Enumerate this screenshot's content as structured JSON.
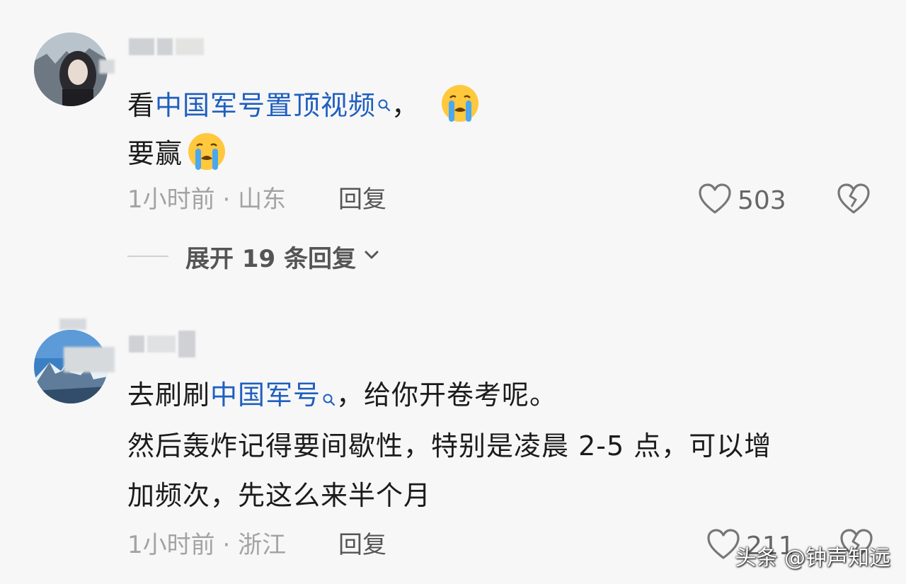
{
  "comments": [
    {
      "username": "",
      "line1_before": "看",
      "line1_link": "中国军号置顶视频",
      "line1_after": "，",
      "line2": "要赢",
      "time": "1小时前",
      "location": "山东",
      "reply_label": "回复",
      "like_count": "503",
      "emoji": "loudly-crying-face"
    },
    {
      "username": "",
      "line1_before": "去刷刷",
      "line1_link": "中国军号",
      "line1_after": "，给你开卷考呢。",
      "line2": "然后轰炸记得要间歇性，特别是凌晨 2-5 点，可以增",
      "line3": "加频次，先这么来半个月",
      "time": "1小时前",
      "location": "浙江",
      "reply_label": "回复",
      "like_count": "211"
    }
  ],
  "expand_replies": {
    "label": "展开 19 条回复"
  },
  "watermark": "头条 @钟声知远",
  "colors": {
    "link": "#1f5fbf",
    "meta": "#a3a3a3",
    "background": "#f7f7f8"
  }
}
